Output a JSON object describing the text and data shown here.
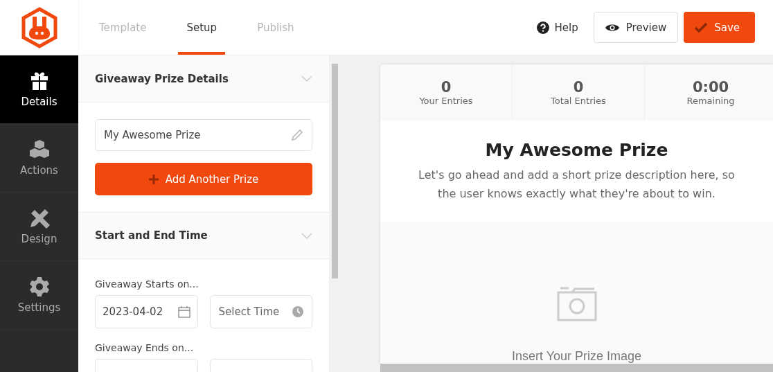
{
  "header": {
    "tabs": [
      {
        "label": "Template",
        "selected": false
      },
      {
        "label": "Setup",
        "selected": true
      },
      {
        "label": "Publish",
        "selected": false
      }
    ],
    "help": "Help",
    "preview": "Preview",
    "save": "Save"
  },
  "sidebar": {
    "items": [
      {
        "label": "Details",
        "kind": "gift",
        "selected": true
      },
      {
        "label": "Actions",
        "kind": "cubes",
        "selected": false
      },
      {
        "label": "Design",
        "kind": "tools",
        "selected": false
      },
      {
        "label": "Settings",
        "kind": "gear",
        "selected": false
      }
    ]
  },
  "prize_section": {
    "title": "Giveaway Prize Details",
    "prize_name": "My Awesome Prize",
    "add_button": "Add Another Prize"
  },
  "time_section": {
    "title": "Start and End Time",
    "starts_label": "Giveaway Starts on...",
    "start_date": "2023-04-02",
    "start_time_placeholder": "Select Time",
    "ends_label": "Giveaway Ends on..."
  },
  "preview": {
    "stats": [
      {
        "value": "0",
        "label": "Your Entries"
      },
      {
        "value": "0",
        "label": "Total Entries"
      },
      {
        "value": "0:00",
        "label": "Remaining"
      }
    ],
    "title": "My Awesome Prize",
    "description": "Let's go ahead and add a short prize description here, so the user knows exactly what they're about to win.",
    "image_hint": "Insert Your Prize Image"
  }
}
